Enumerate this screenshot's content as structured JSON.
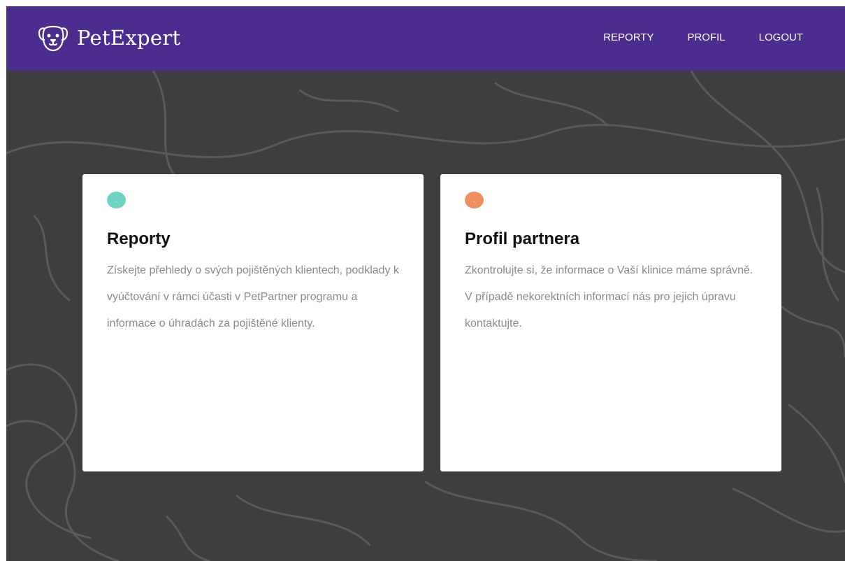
{
  "header": {
    "brand": "PetExpert",
    "brand_icon": "dog-face-icon",
    "background": "#4b2c8f",
    "nav": [
      {
        "label": "REPORTY"
      },
      {
        "label": "PROFIL"
      },
      {
        "label": "LOGOUT"
      }
    ]
  },
  "page": {
    "background": "#3e3e3e"
  },
  "cards": [
    {
      "title": "Reporty",
      "text": "Získejte přehledy o svých pojištěných klientech, podklady k vyúčtování v rámci účasti v PetPartner programu a informace o úhradách za pojištěné klienty.",
      "dot_color": "#6fd3c4"
    },
    {
      "title": "Profil partnera",
      "text": "Zkontrolujte si, že informace o Vaší klinice máme správně. V případě nekorektních informací nás pro jejich úpravu kontaktujte.",
      "dot_color": "#ef8f60"
    }
  ]
}
